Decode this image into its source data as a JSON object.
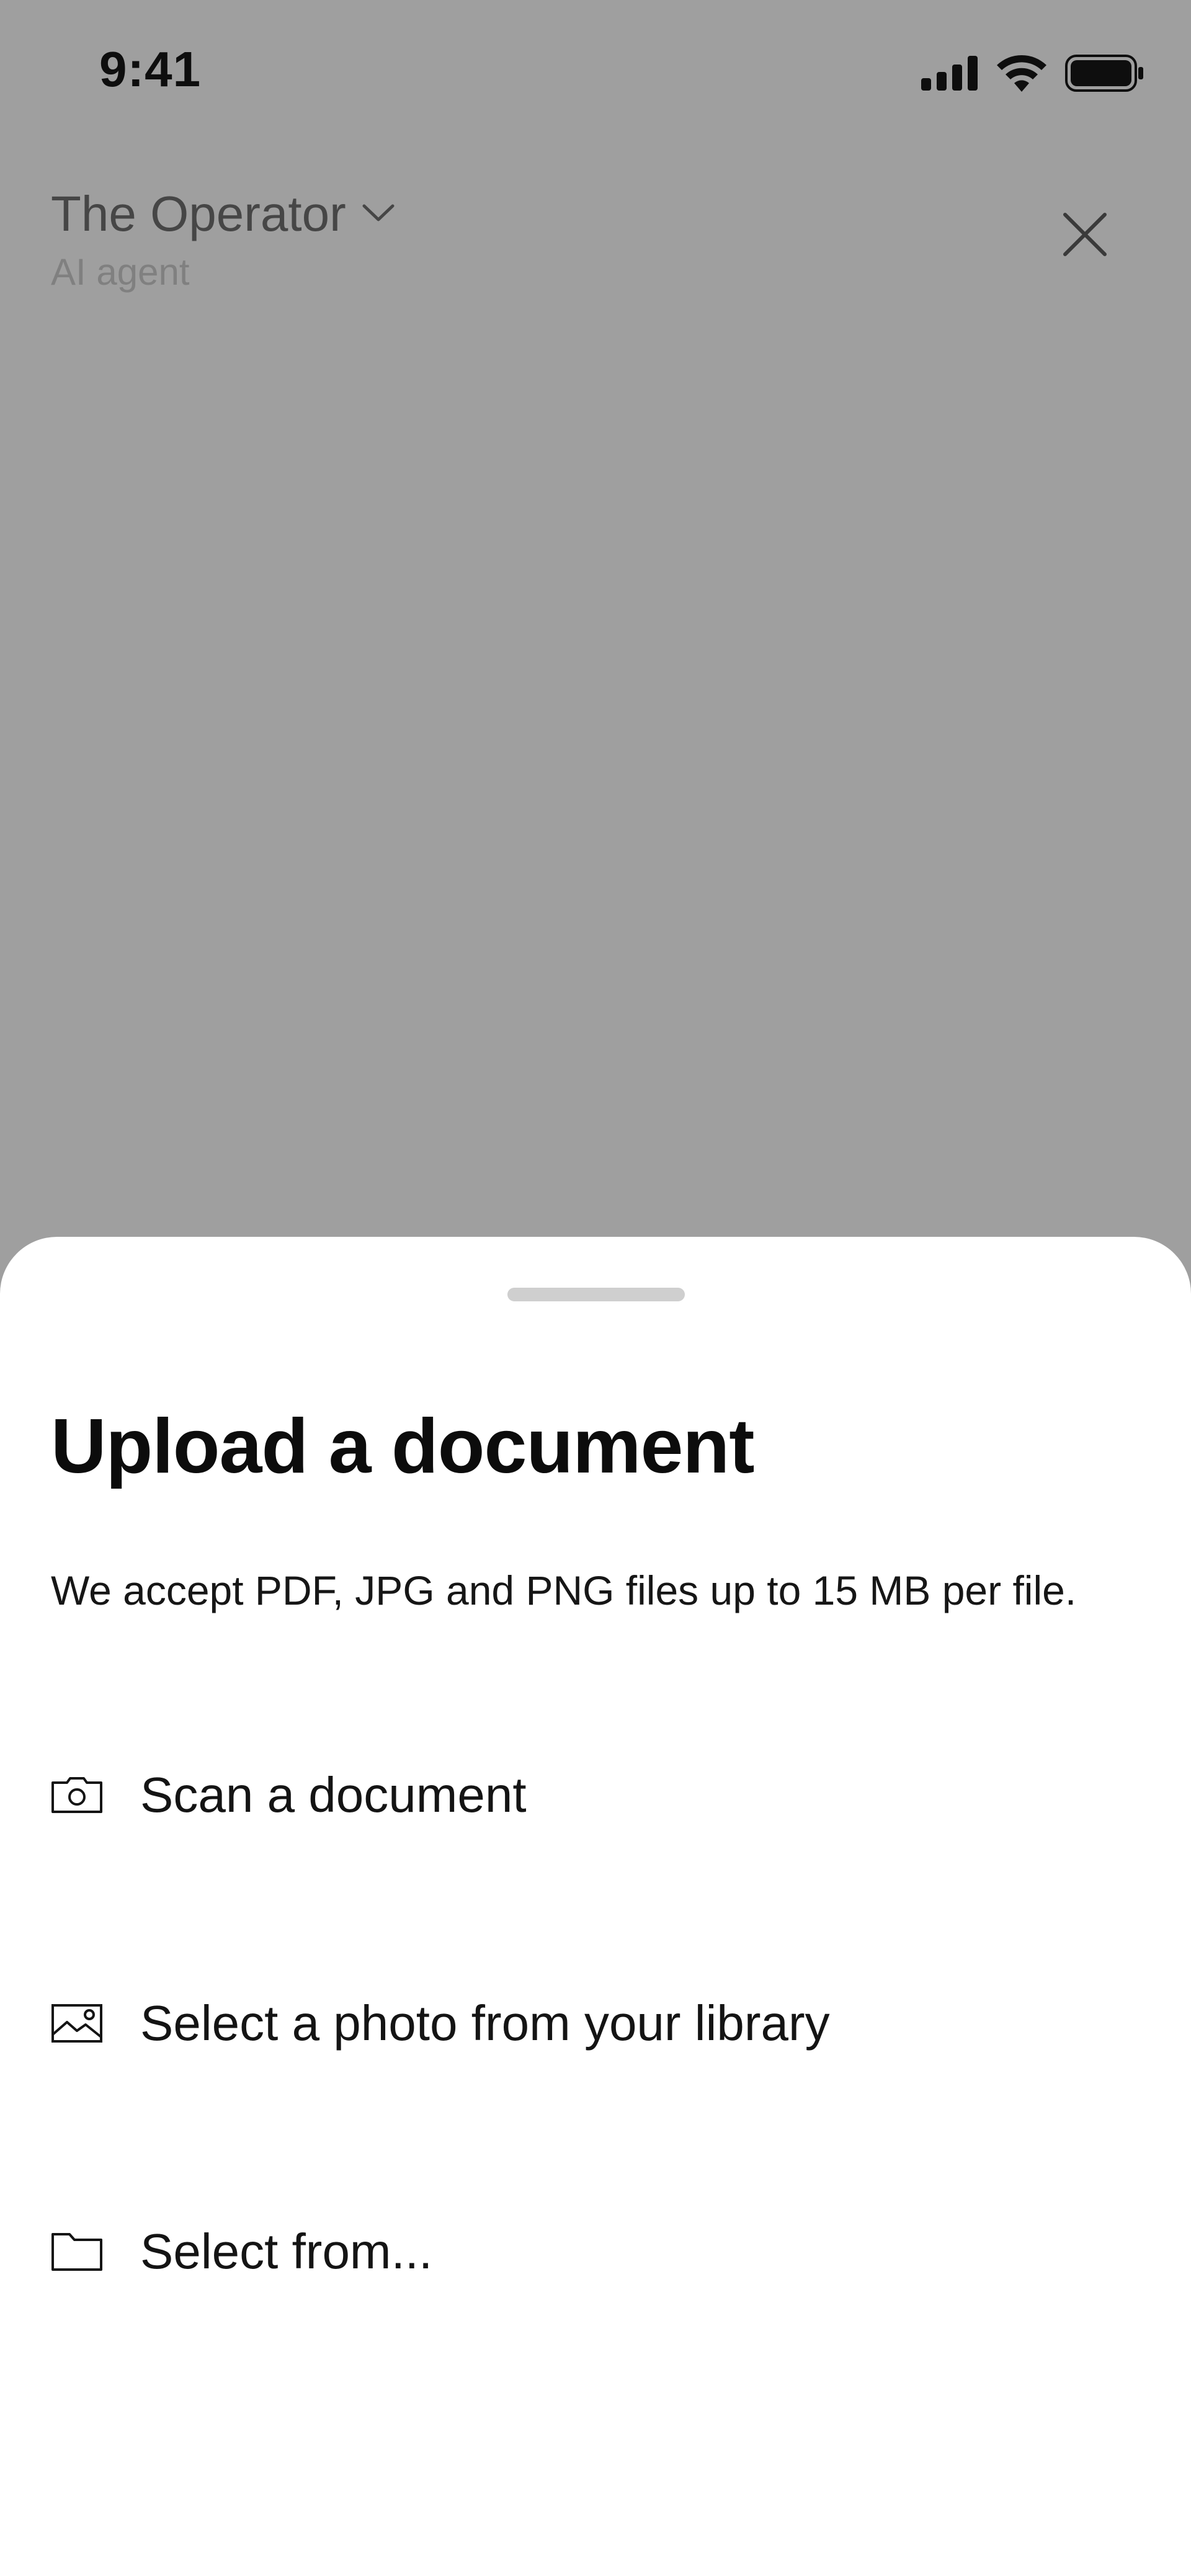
{
  "status_bar": {
    "time": "9:41",
    "icons": [
      "cellular-signal-icon",
      "wifi-icon",
      "battery-icon"
    ]
  },
  "header": {
    "agent_name": "The Operator",
    "agent_subtitle": "AI agent",
    "icons": [
      "chevron-down-icon",
      "close-icon"
    ]
  },
  "sheet": {
    "title": "Upload a document",
    "description": "We accept PDF, JPG and PNG files up to 15 MB per file.",
    "options": [
      {
        "label": "Scan a document",
        "icon": "camera-icon"
      },
      {
        "label": "Select a photo from your library",
        "icon": "image-icon"
      },
      {
        "label": "Select from...",
        "icon": "folder-icon"
      }
    ]
  },
  "colors": {
    "overlay": "#9f9f9f",
    "sheet": "#ffffff",
    "text": "#111111",
    "muted": "#808080",
    "grabber": "#cfcfcf"
  }
}
